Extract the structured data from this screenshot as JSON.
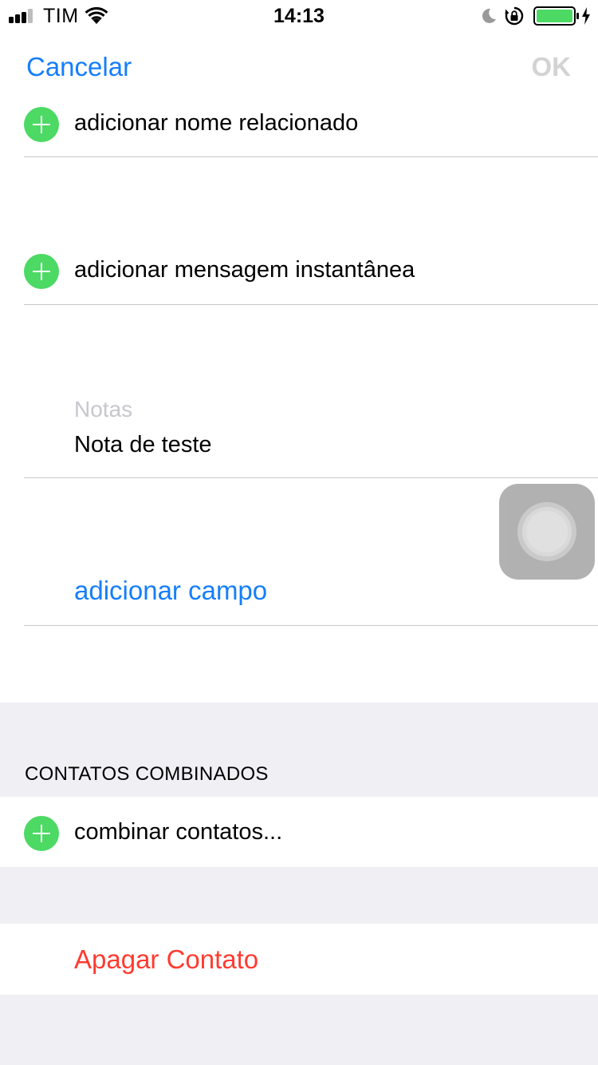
{
  "status_bar": {
    "carrier": "TIM",
    "time": "14:13",
    "icons": [
      "signal-icon",
      "wifi-icon",
      "moon-icon",
      "orientation-lock-icon",
      "battery-icon",
      "charging-icon"
    ],
    "battery_color": "#4cd964"
  },
  "nav": {
    "cancel_label": "Cancelar",
    "ok_label": "OK"
  },
  "rows": {
    "add_related_name": "adicionar nome relacionado",
    "add_instant_message": "adicionar mensagem instantânea"
  },
  "notes": {
    "label": "Notas",
    "value": "Nota de teste"
  },
  "add_field_label": "adicionar campo",
  "linked_contacts": {
    "header": "CONTATOS COMBINADOS",
    "link_label": "combinar contatos..."
  },
  "delete_label": "Apagar Contato",
  "colors": {
    "accent": "#157efb",
    "add": "#4cd964",
    "destructive": "#ff3b30",
    "grouped_background": "#efeff4"
  }
}
